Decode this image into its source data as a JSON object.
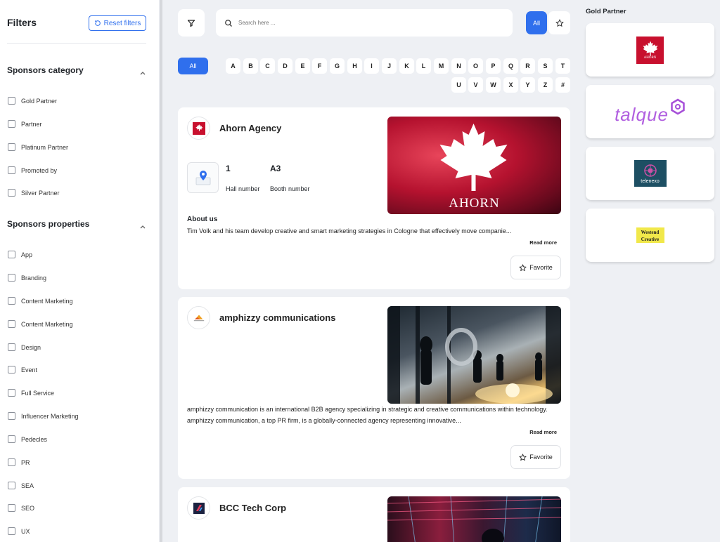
{
  "sidebar": {
    "title": "Filters",
    "reset_label": "Reset filters",
    "category": {
      "title": "Sponsors category",
      "items": [
        "Gold Partner",
        "Partner",
        "Platinum Partner",
        "Promoted by",
        "Silver Partner"
      ]
    },
    "properties": {
      "title": "Sponsors properties",
      "items": [
        "App",
        "Branding",
        "Content Marketing",
        "Content Marketing",
        "Design",
        "Event",
        "Full Service",
        "Influencer Marketing",
        "Pedecles",
        "PR",
        "SEA",
        "SEO",
        "UX"
      ]
    }
  },
  "search": {
    "placeholder": "Search here ..."
  },
  "toggle": {
    "all_label": "All"
  },
  "alphabet": {
    "all_label": "All",
    "letters": [
      "A",
      "B",
      "C",
      "D",
      "E",
      "F",
      "G",
      "H",
      "I",
      "J",
      "K",
      "L",
      "M",
      "N",
      "O",
      "P",
      "Q",
      "R",
      "S",
      "T",
      "U",
      "V",
      "W",
      "X",
      "Y",
      "Z",
      "#"
    ]
  },
  "cards": [
    {
      "name": "Ahorn Agency",
      "hall_number": "1",
      "hall_label": "Hall number",
      "booth_number": "A3",
      "booth_label": "Booth number",
      "about_label": "About us",
      "description": "Tim Volk and his team develop creative and smart marketing strategies in Cologne that effectively move companie...",
      "read_more": "Read more",
      "favorite": "Favorite",
      "image_text": "AHORN"
    },
    {
      "name": "amphizzy communications",
      "description": "amphizzy communication is an international B2B agency specializing in strategic and creative communications within technology. amphizzy communication, a top PR firm, is a globally-connected agency representing innovative...",
      "read_more": "Read more",
      "favorite": "Favorite"
    },
    {
      "name": "BCC Tech Corp"
    }
  ],
  "gold_partner": {
    "title": "Gold Partner",
    "logos": [
      "AHORN",
      "talque",
      "telenexo",
      "Westend Creative"
    ]
  },
  "colors": {
    "accent": "#2f6fed",
    "ahorn_red": "#c8102e",
    "talque_purple": "#b15fe0",
    "telenexo_teal": "#1d4f63"
  }
}
